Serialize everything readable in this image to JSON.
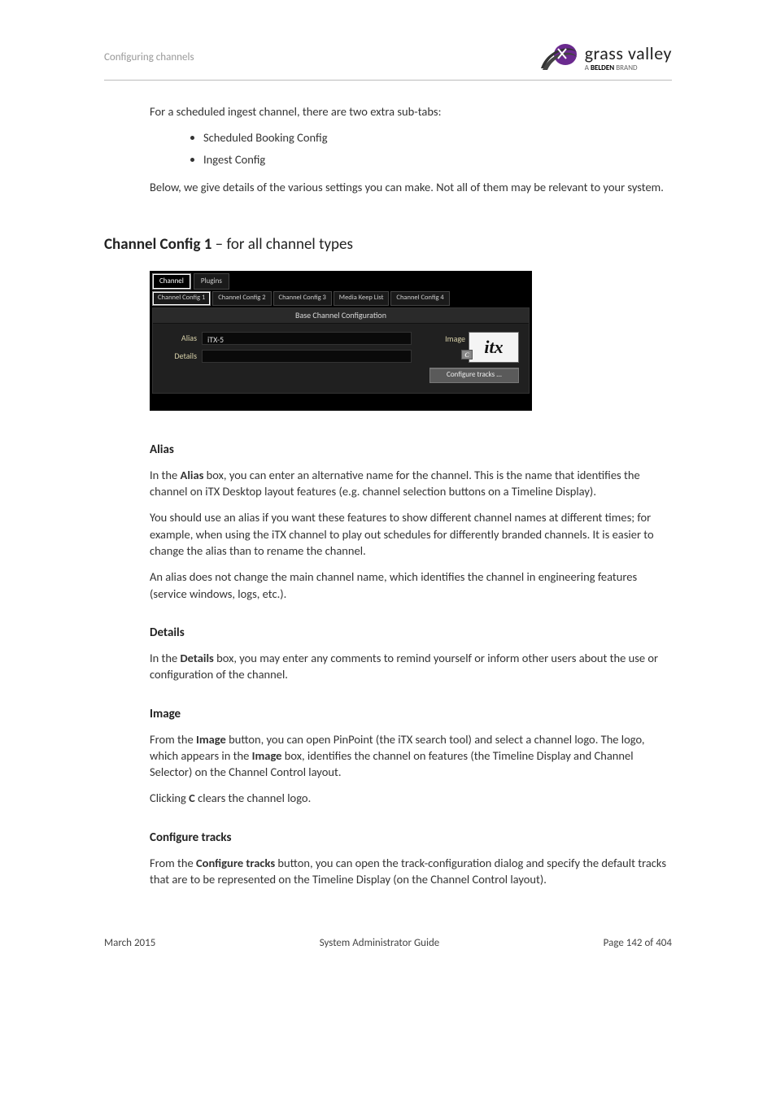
{
  "header": {
    "breadcrumb": "Configuring channels",
    "logo_brand": "grass valley",
    "logo_tag_pre": "A ",
    "logo_tag_bold": "BELDEN",
    "logo_tag_post": " BRAND"
  },
  "intro": {
    "line1": "For a scheduled ingest channel, there are two extra sub-tabs:",
    "bullets": [
      "Scheduled Booking Config",
      "Ingest Config"
    ],
    "line2": "Below, we give details of the various settings you can make. Not all of them may be relevant to your system."
  },
  "section": {
    "title_bold": "Channel Config 1",
    "title_light": " – for all channel types"
  },
  "ui": {
    "tabs": {
      "channel": "Channel",
      "plugins": "Plugins"
    },
    "subtabs": {
      "c1": "Channel Config 1",
      "c2": "Channel Config 2",
      "c3": "Channel Config 3",
      "mkl": "Media Keep List",
      "c4": "Channel Config 4"
    },
    "panel_title": "Base Channel Configuration",
    "fields": {
      "alias_label": "Alias",
      "alias_value": "iTX-5",
      "details_label": "Details",
      "details_value": ""
    },
    "image_label": "Image",
    "image_logo_text": "itx",
    "c_button": "C",
    "configure_tracks": "Configure tracks ..."
  },
  "sections": {
    "alias": {
      "title": "Alias",
      "p1_a": "In the ",
      "p1_b": "Alias",
      "p1_c": " box, you can enter an alternative name for the channel. This is the name that identifies the channel on iTX Desktop layout features (e.g. channel selection buttons on a Timeline Display).",
      "p2": "You should use an alias if you want these features to show different channel names at different times; for example, when using the iTX channel to play out schedules for differently branded channels. It is easier to change the alias than to rename the channel.",
      "p3": "An alias does not change the main channel name, which identifies the channel in engineering features (service windows, logs, etc.)."
    },
    "details": {
      "title": "Details",
      "p1_a": "In the ",
      "p1_b": "Details",
      "p1_c": " box, you may enter any comments to remind yourself or inform other users about the use or configuration of the channel."
    },
    "image": {
      "title": "Image",
      "p1_a": "From the ",
      "p1_b": "Image",
      "p1_c": " button, you can open PinPoint (the iTX search tool) and select a channel logo. The logo, which appears in the ",
      "p1_d": "Image",
      "p1_e": " box, identifies the channel on features (the Timeline Display and Channel Selector) on the Channel Control layout.",
      "p2_a": "Clicking ",
      "p2_b": "C",
      "p2_c": " clears the channel logo."
    },
    "configure_tracks": {
      "title": "Configure tracks",
      "p1_a": "From the ",
      "p1_b": "Configure tracks",
      "p1_c": " button, you can open the track-configuration dialog and specify the default tracks that are to be represented on the Timeline Display (on the Channel Control layout)."
    }
  },
  "footer": {
    "left": "March 2015",
    "center": "System Administrator Guide",
    "right": "Page 142 of 404"
  }
}
